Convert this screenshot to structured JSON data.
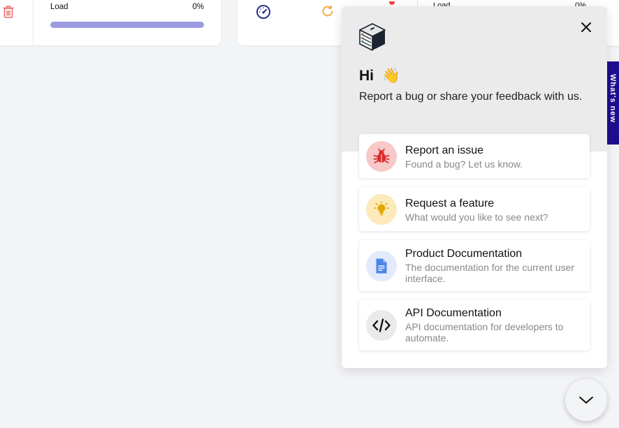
{
  "background": {
    "left_card": {
      "load_label": "Load",
      "load_percent": "0%",
      "load_fill_fraction": 1.0
    },
    "mid_card": {
      "label": "Load",
      "percent": "0%"
    },
    "side_tab_label": "What's new"
  },
  "widget": {
    "greeting": "Hi",
    "greeting_emoji": "👋",
    "subtitle": "Report a bug or share your feedback with us.",
    "options": [
      {
        "title": "Report an issue",
        "description": "Found a bug? Let us know.",
        "icon": "bug-icon",
        "color": "#d92d2d"
      },
      {
        "title": "Request a feature",
        "description": "What would you like to see next?",
        "icon": "lightbulb-icon",
        "color": "#e0a800"
      },
      {
        "title": "Product Documentation",
        "description": "The documentation for the current user interface.",
        "icon": "document-icon",
        "color": "#4a86e8"
      },
      {
        "title": "API Documentation",
        "description": "API documentation for developers to automate.",
        "icon": "code-icon",
        "color": "#111111"
      }
    ]
  },
  "colors": {
    "accent": "#1e0e8f",
    "progress": "#9b9be0"
  }
}
